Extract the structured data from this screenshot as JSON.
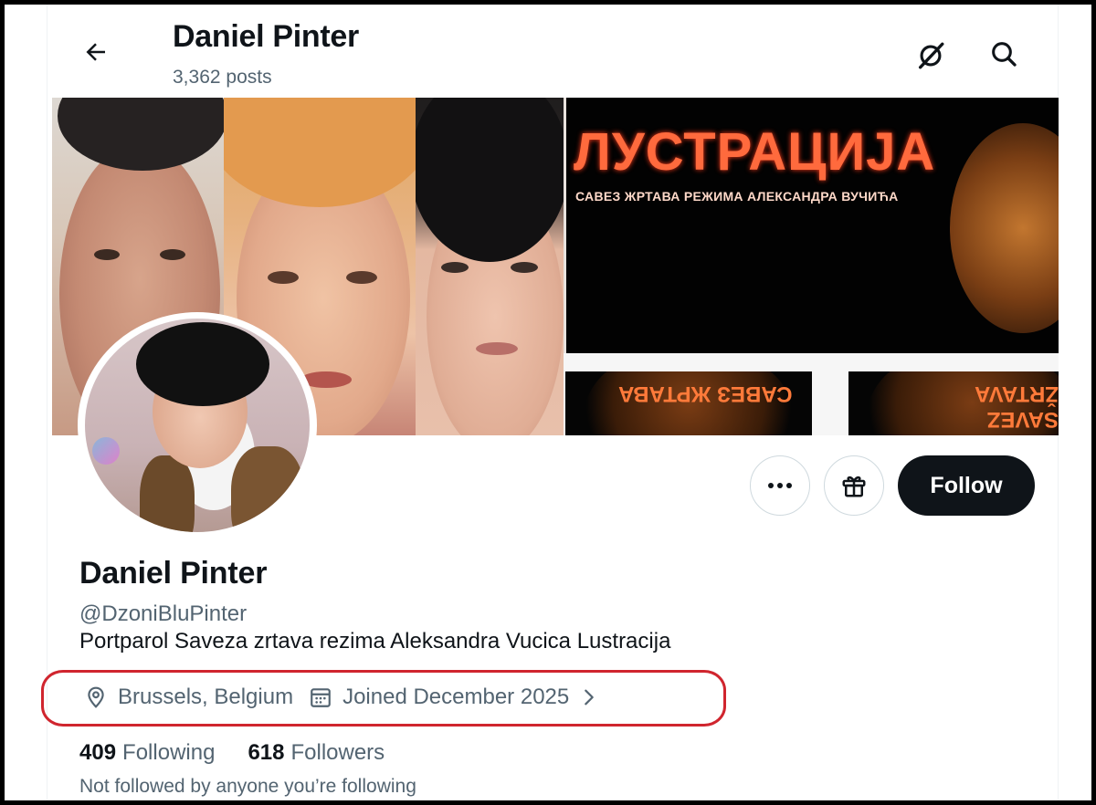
{
  "header": {
    "title": "Daniel Pinter",
    "posts": "3,362 posts"
  },
  "banner": {
    "poster_title": "ЛУСТРАЦИЈА",
    "poster_subtitle": "САВЕЗ ЖРТАВА РЕЖИМА АЛЕКСАНДРА ВУЧИЋА",
    "tile_left_text": "САВЕЗ ЖРТАВА",
    "tile_right_text": "SAVEZ ŽRTAVA"
  },
  "profile": {
    "name": "Daniel Pinter",
    "handle": "@DzoniBluPinter",
    "bio": "Portparol Saveza zrtava rezima Aleksandra Vucica Lustracija",
    "location": "Brussels, Belgium",
    "joined": "Joined December 2025",
    "following_count": "409",
    "following_label": "Following",
    "followers_count": "618",
    "followers_label": "Followers",
    "not_followed": "Not followed by anyone you’re following"
  },
  "actions": {
    "follow_label": "Follow"
  },
  "icons": {
    "back": "arrow-left-icon",
    "grok": "grok-slash-icon",
    "search": "search-icon",
    "more": "more-dots-icon",
    "gift": "gift-icon",
    "location": "location-pin-icon",
    "calendar": "calendar-icon",
    "chevron": "chevron-right-icon"
  },
  "colors": {
    "text": "#0f1419",
    "secondary": "#536471",
    "follow_bg": "#0f1419",
    "highlight": "#d0252e",
    "poster_accent": "#ff6a3d"
  }
}
